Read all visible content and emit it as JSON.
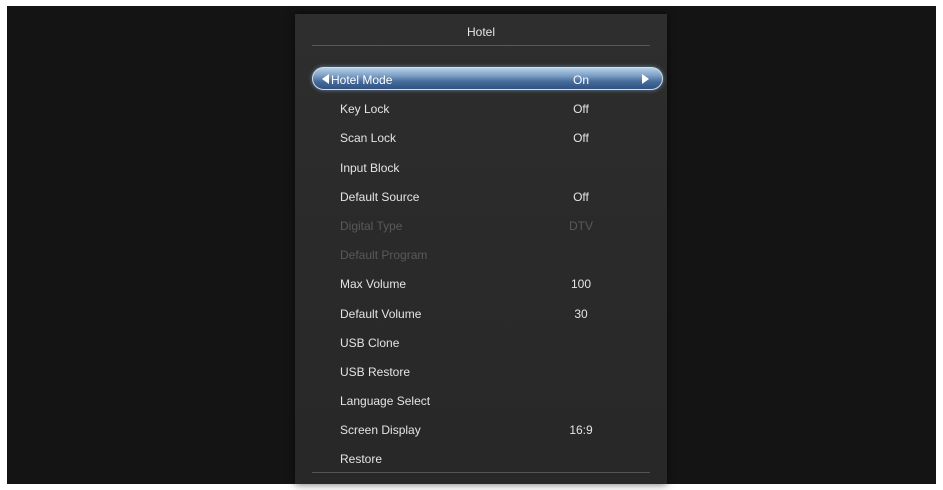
{
  "menu": {
    "title": "Hotel",
    "items": [
      {
        "label": "Hotel Mode",
        "value": "On"
      },
      {
        "label": "Key Lock",
        "value": "Off"
      },
      {
        "label": "Scan Lock",
        "value": "Off"
      },
      {
        "label": "Input Block",
        "value": ""
      },
      {
        "label": "Default Source",
        "value": "Off"
      },
      {
        "label": "Digital Type",
        "value": "DTV"
      },
      {
        "label": "Default Program",
        "value": ""
      },
      {
        "label": "Max Volume",
        "value": "100"
      },
      {
        "label": "Default Volume",
        "value": "30"
      },
      {
        "label": "USB Clone",
        "value": ""
      },
      {
        "label": "USB Restore",
        "value": ""
      },
      {
        "label": "Language Select",
        "value": ""
      },
      {
        "label": "Screen Display",
        "value": "16:9"
      },
      {
        "label": "Restore",
        "value": ""
      }
    ]
  },
  "icons": {
    "left": "triangle-left-icon",
    "right": "triangle-right-icon"
  },
  "colors": {
    "highlight": "#5f84b2",
    "disabled_text": "#595959",
    "text": "#e4e4e4"
  }
}
